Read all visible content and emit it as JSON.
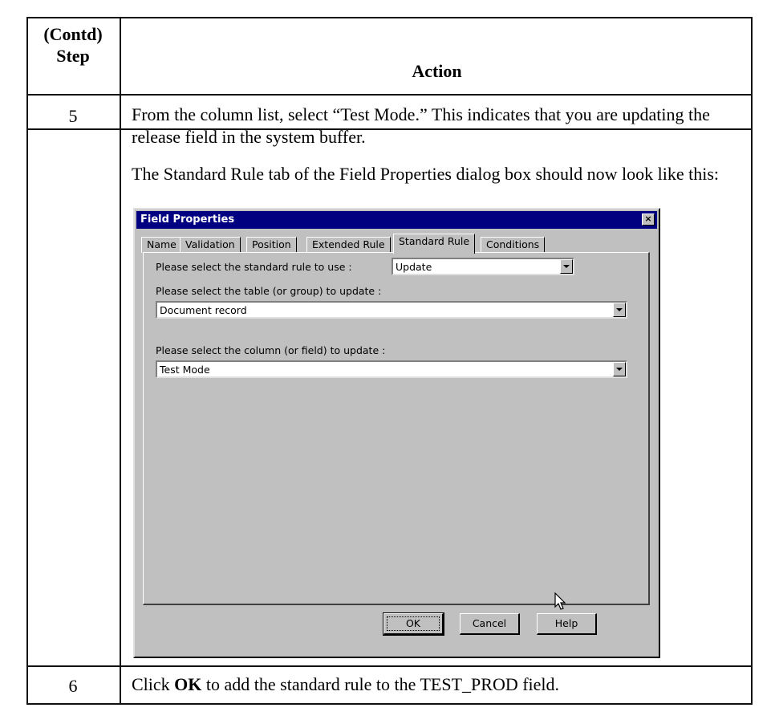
{
  "table": {
    "header": {
      "step_line1": "(Contd)",
      "step_line2": "Step",
      "action": "Action"
    },
    "rows": [
      {
        "step": "5",
        "text1": "From the column list, select “Test Mode.” This indicates that you are updating the release field in the system buffer.",
        "text2": "The Standard Rule tab of the Field Properties dialog box should now look like this:"
      },
      {
        "step": "6",
        "text_before": "Click ",
        "text_bold": "OK",
        "text_after": " to add the standard rule to the TEST_PROD field."
      }
    ]
  },
  "dialog": {
    "title": "Field Properties",
    "close_glyph": "×",
    "tabs": [
      "Name",
      "Validation",
      "Position",
      "Extended Rule",
      "Standard Rule",
      "Conditions"
    ],
    "active_tab": "Standard Rule",
    "rule_label": "Please select the standard rule to use :",
    "rule_value": "Update",
    "table_label": "Please select the table (or group) to update :",
    "table_value": "Document record",
    "column_label": "Please select the column (or field) to update :",
    "column_value": "Test Mode",
    "buttons": {
      "ok": "OK",
      "cancel": "Cancel",
      "help": "Help"
    }
  },
  "icons": {
    "dropdown": "dropdown-arrow-icon",
    "cursor": "mouse-pointer-icon",
    "close": "close-icon"
  }
}
